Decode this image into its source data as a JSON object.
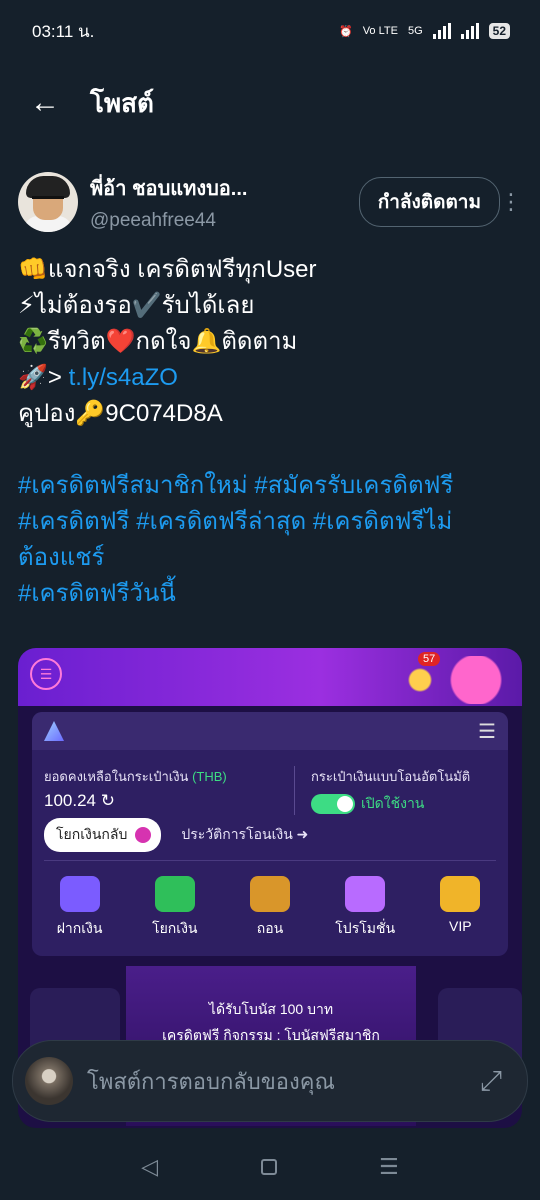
{
  "status": {
    "time": "03:11 น.",
    "volte": "Vo LTE",
    "net": "5G",
    "battery": "52"
  },
  "header": {
    "title": "โพสต์"
  },
  "author": {
    "display_name": "พี่อ้า ชอบแทงบอ...",
    "handle": "@peeahfree44",
    "follow_label": "กำลังติดตาม"
  },
  "post": {
    "line1": "👊แจกจริง เครดิตฟรีทุกUser",
    "line2": "⚡ไม่ต้องรอ✔️รับได้เลย",
    "line3": "♻️รีทวิต❤️กดใจ🔔ติดตาม",
    "line4_prefix": "🚀> ",
    "link": "t.ly/s4aZO",
    "line5": "คูปอง🔑9C074D8A",
    "hashtags_line1": "#เครดิตฟรีสมาชิกใหม่ #สมัครรับเครดิตฟรี",
    "hashtags_line2": "#เครดิตฟรี #เครดิตฟรีล่าสุด #เครดิตฟรีไม่",
    "hashtags_line3": "ต้องแชร์",
    "hashtags_line4": "#เครดิตฟรีวันนี้"
  },
  "media": {
    "badge": "57",
    "balance_label": "ยอดคงเหลือในกระเป๋าเงิน",
    "currency": "(THB)",
    "balance": "100.24",
    "auto_wallet_label": "กระเป๋าเงินแบบโอนอัตโนมัติ",
    "auto_state": "เปิดใช้งาน",
    "withdraw_btn": "โยกเงินกลับ",
    "history": "ประวัติการโอนเงิน",
    "icons": [
      {
        "label": "ฝากเงิน",
        "color": "#7b5cff"
      },
      {
        "label": "โยกเงิน",
        "color": "#2fbf5a"
      },
      {
        "label": "ถอน",
        "color": "#d9962a"
      },
      {
        "label": "โปรโมชั่น",
        "color": "#b86bff"
      },
      {
        "label": "VIP",
        "color": "#f0b429"
      }
    ],
    "banner_line1": "ได้รับโบนัส 100 บาท",
    "banner_line2": "เครดิตฟรี กิจกรรม : โบนัสฟรีสมาชิก"
  },
  "reply": {
    "placeholder": "โพสต์การตอบกลับของคุณ"
  }
}
